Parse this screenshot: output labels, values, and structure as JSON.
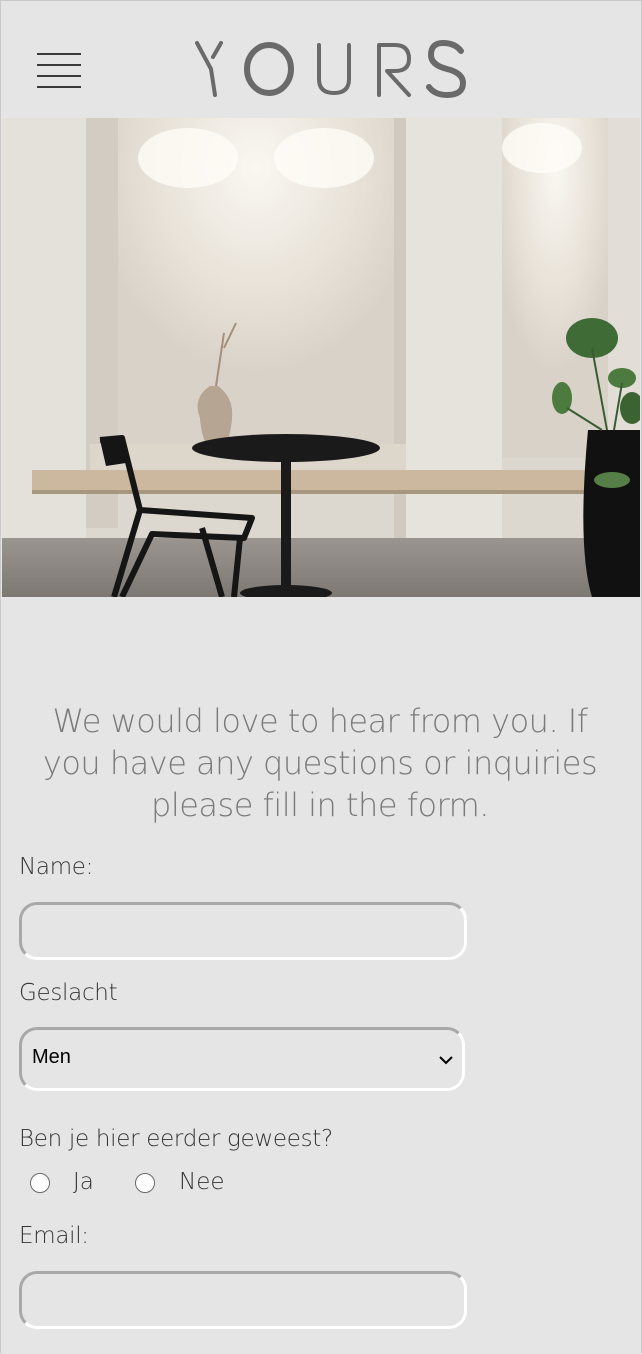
{
  "header": {
    "logo_text": "YOURS"
  },
  "hero": {
    "alt": "Minimalist interior with round black table, chair and vase"
  },
  "intro": {
    "text": "We would love to hear from you. If you have any questions or inquiries please fill in the form."
  },
  "form": {
    "name_label": "Name:",
    "name_value": "",
    "gender_label": "Geslacht",
    "gender_selected": "Men",
    "visited_label": "Ben je hier eerder geweest?",
    "visited_options": [
      "Ja",
      "Nee"
    ],
    "email_label": "Email:",
    "email_value": ""
  },
  "colors": {
    "background": "#e5e5e5",
    "logo": "#6a6a6a",
    "intro_text": "#7a7a7a"
  }
}
